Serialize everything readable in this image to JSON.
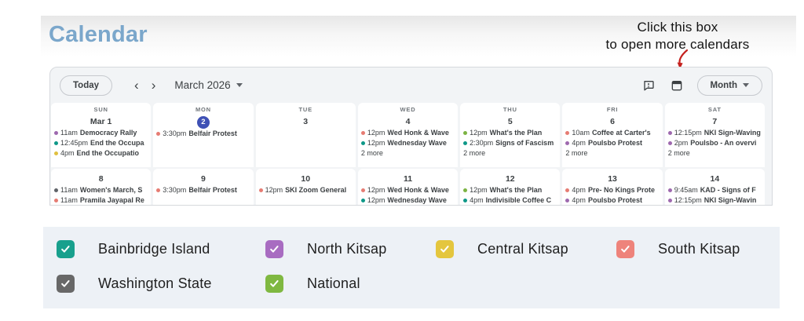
{
  "page": {
    "title": "Calendar"
  },
  "annotation": {
    "line1": "Click this box",
    "line2": "to open more calendars",
    "arrow_color": "#c5221f"
  },
  "toolbar": {
    "today": "Today",
    "prev": "‹",
    "next": "›",
    "date_label": "March 2026",
    "view_label": "Month"
  },
  "event_colors": {
    "salmon": "#e67c73",
    "teal": "#0e9888",
    "purple": "#9e69af",
    "yellow": "#e0c03f",
    "green": "#7cb342",
    "gray": "#5f6368"
  },
  "today_color": "#3f51b5",
  "calendar": {
    "weeks": [
      {
        "days": [
          {
            "weekday": "SUN",
            "date": "Mar 1",
            "today": false,
            "more": "",
            "events": [
              {
                "c": "purple",
                "time": "11am",
                "title": "Democracy Rally"
              },
              {
                "c": "teal",
                "time": "12:45pm",
                "title": "End the Occupa"
              },
              {
                "c": "yellow",
                "time": "4pm",
                "title": "End the Occupatio"
              }
            ]
          },
          {
            "weekday": "MON",
            "date": "2",
            "today": true,
            "more": "",
            "events": [
              {
                "c": "salmon",
                "time": "3:30pm",
                "title": "Belfair Protest"
              }
            ]
          },
          {
            "weekday": "TUE",
            "date": "3",
            "today": false,
            "more": "",
            "events": []
          },
          {
            "weekday": "WED",
            "date": "4",
            "today": false,
            "more": "2 more",
            "events": [
              {
                "c": "salmon",
                "time": "12pm",
                "title": "Wed Honk & Wave"
              },
              {
                "c": "teal",
                "time": "12pm",
                "title": "Wednesday Wave"
              }
            ]
          },
          {
            "weekday": "THU",
            "date": "5",
            "today": false,
            "more": "2 more",
            "events": [
              {
                "c": "green",
                "time": "12pm",
                "title": "What's the Plan"
              },
              {
                "c": "teal",
                "time": "2:30pm",
                "title": "Signs of Fascism"
              }
            ]
          },
          {
            "weekday": "FRI",
            "date": "6",
            "today": false,
            "more": "2 more",
            "events": [
              {
                "c": "salmon",
                "time": "10am",
                "title": "Coffee at Carter's"
              },
              {
                "c": "purple",
                "time": "4pm",
                "title": "Poulsbo Protest"
              }
            ]
          },
          {
            "weekday": "SAT",
            "date": "7",
            "today": false,
            "more": "2 more",
            "events": [
              {
                "c": "purple",
                "time": "12:15pm",
                "title": "NKI Sign-Waving"
              },
              {
                "c": "purple",
                "time": "2pm",
                "title": "Poulsbo - An overvi"
              }
            ]
          }
        ]
      },
      {
        "days": [
          {
            "date": "8",
            "today": false,
            "more": "",
            "events": [
              {
                "c": "gray",
                "time": "11am",
                "title": "Women's March, S"
              },
              {
                "c": "salmon",
                "time": "11am",
                "title": "Pramila Jayapal Re"
              }
            ]
          },
          {
            "date": "9",
            "today": false,
            "more": "",
            "events": [
              {
                "c": "salmon",
                "time": "3:30pm",
                "title": "Belfair Protest"
              }
            ]
          },
          {
            "date": "10",
            "today": false,
            "more": "",
            "events": [
              {
                "c": "salmon",
                "time": "12pm",
                "title": "SKI Zoom General"
              }
            ]
          },
          {
            "date": "11",
            "today": false,
            "more": "",
            "events": [
              {
                "c": "salmon",
                "time": "12pm",
                "title": "Wed Honk & Wave"
              },
              {
                "c": "teal",
                "time": "12pm",
                "title": "Wednesday Wave"
              }
            ]
          },
          {
            "date": "12",
            "today": false,
            "more": "",
            "events": [
              {
                "c": "green",
                "time": "12pm",
                "title": "What's the Plan"
              },
              {
                "c": "teal",
                "time": "4pm",
                "title": "Indivisible Coffee C"
              }
            ]
          },
          {
            "date": "13",
            "today": false,
            "more": "",
            "events": [
              {
                "c": "salmon",
                "time": "4pm",
                "title": "Pre- No Kings Prote"
              },
              {
                "c": "purple",
                "time": "4pm",
                "title": "Poulsbo Protest"
              }
            ]
          },
          {
            "date": "14",
            "today": false,
            "more": "",
            "events": [
              {
                "c": "purple",
                "time": "9:45am",
                "title": "KAD - Signs of F"
              },
              {
                "c": "purple",
                "time": "12:15pm",
                "title": "NKI Sign-Wavin"
              }
            ]
          }
        ]
      }
    ]
  },
  "legend": {
    "items": [
      {
        "label": "Bainbridge Island",
        "color": "#18a08d"
      },
      {
        "label": "North Kitsap",
        "color": "#a86cc1"
      },
      {
        "label": "Central Kitsap",
        "color": "#e4c63e"
      },
      {
        "label": "South Kitsap",
        "color": "#ee837b"
      },
      {
        "label": "Washington State",
        "color": "#686868"
      },
      {
        "label": "National",
        "color": "#7fb841"
      }
    ]
  }
}
